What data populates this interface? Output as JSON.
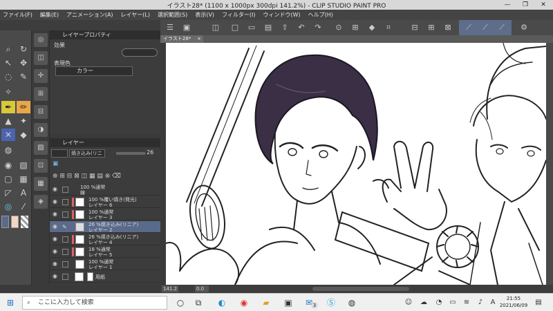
{
  "window": {
    "title": "イラスト28* (1100 x 1000px 300dpi 141.2%) - CLIP STUDIO PAINT PRO",
    "min": "—",
    "max": "❐",
    "close": "✕"
  },
  "menu": [
    "ファイル(F)",
    "編集(E)",
    "アニメーション(A)",
    "レイヤー(L)",
    "選択範囲(S)",
    "表示(V)",
    "フィルター(I)",
    "ウィンドウ(W)",
    "ヘルプ(H)"
  ],
  "property_panel": {
    "header": "レイヤープロパティ",
    "effect_label": "効果",
    "color_label": "表現色",
    "color_value": "カラー"
  },
  "layer_panel": {
    "header": "レイヤー",
    "blend_mode": "焼き込み(リニア)",
    "opacity": "26",
    "layers": [
      {
        "l1": "100 %通常",
        "l2": "線"
      },
      {
        "l1": "100 %覆い焼き(発光)",
        "l2": "レイヤー 6"
      },
      {
        "l1": "100 %通常",
        "l2": "レイヤー 3"
      },
      {
        "l1": "26 %焼き込み(リニア)",
        "l2": "レイヤー 2"
      },
      {
        "l1": "26 %焼き込み(リニア)",
        "l2": "レイヤー 4"
      },
      {
        "l1": "18 %通常",
        "l2": "レイヤー 5"
      },
      {
        "l1": "100 %通常",
        "l2": "レイヤー 1"
      },
      {
        "l1": "",
        "l2": "用紙"
      }
    ]
  },
  "tab": {
    "label": "イラスト28*",
    "close": "×"
  },
  "status": {
    "zoom": "141.2",
    "angle": "0.0"
  },
  "taskbar": {
    "search_placeholder": "ここに入力して検索",
    "mail_badge": "3",
    "ime": "A",
    "time": "21:55",
    "date": "2021/06/09"
  },
  "colors": {
    "accent": "#5a6a8a",
    "hair": "#3a2f45",
    "line": "#222222"
  }
}
